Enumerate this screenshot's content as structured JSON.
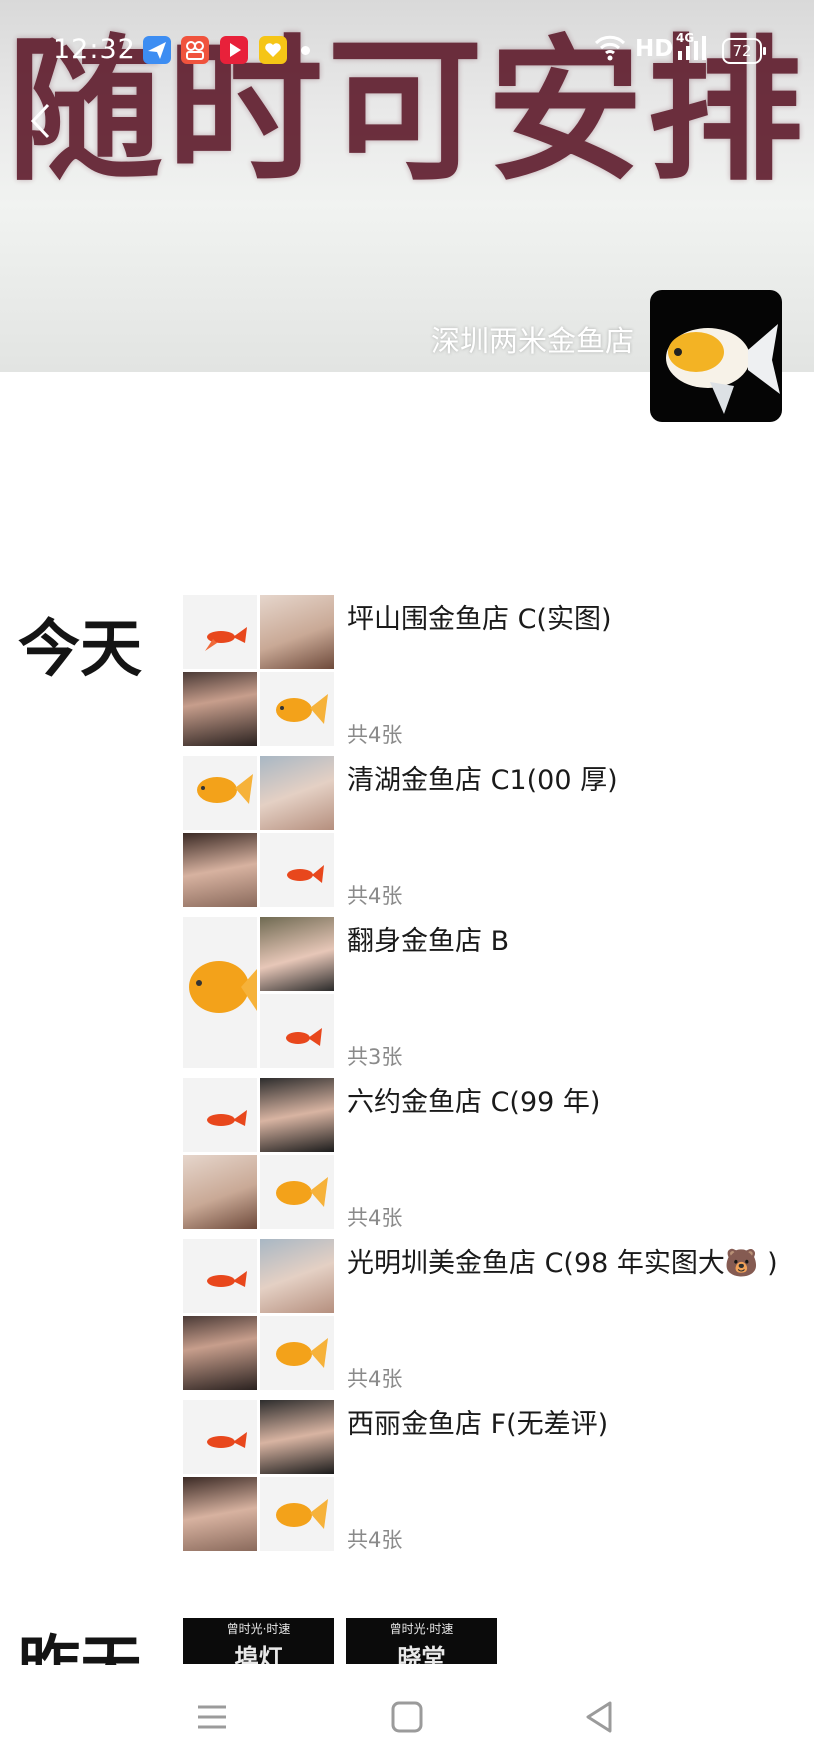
{
  "status_bar": {
    "time": "12:32",
    "network": "HD",
    "signal_label": "4G",
    "battery": "72",
    "app_icons": [
      "paper-plane-app-icon",
      "photo-app-icon",
      "video-play-app-icon",
      "heart-app-icon"
    ]
  },
  "cover": {
    "banner_text": "随时可安排",
    "profile_name": "深圳两米金鱼店",
    "banner_color": "#5a1526"
  },
  "sections": [
    {
      "day": "今天",
      "posts": [
        {
          "title": "坪山围金鱼店 C(实图)",
          "count": "共4张"
        },
        {
          "title": "清湖金鱼店 C1(00 厚)",
          "count": "共4张"
        },
        {
          "title": "翻身金鱼店 B",
          "count": "共3张"
        },
        {
          "title": "六约金鱼店 C(99 年)",
          "count": "共4张"
        },
        {
          "title": "光明圳美金鱼店 C(98 年实图大🐻 )",
          "count": "共4张"
        },
        {
          "title": "西丽金鱼店 F(无差评)",
          "count": "共4张"
        }
      ]
    },
    {
      "day": "昨天",
      "thumb_text": [
        "曾时光·时速",
        "曾时光·时速"
      ],
      "thumb_text_2": [
        "埠灯",
        "晓堂"
      ]
    }
  ],
  "nav": {
    "icons": [
      "menu-icon",
      "home-square-icon",
      "back-triangle-icon"
    ]
  }
}
